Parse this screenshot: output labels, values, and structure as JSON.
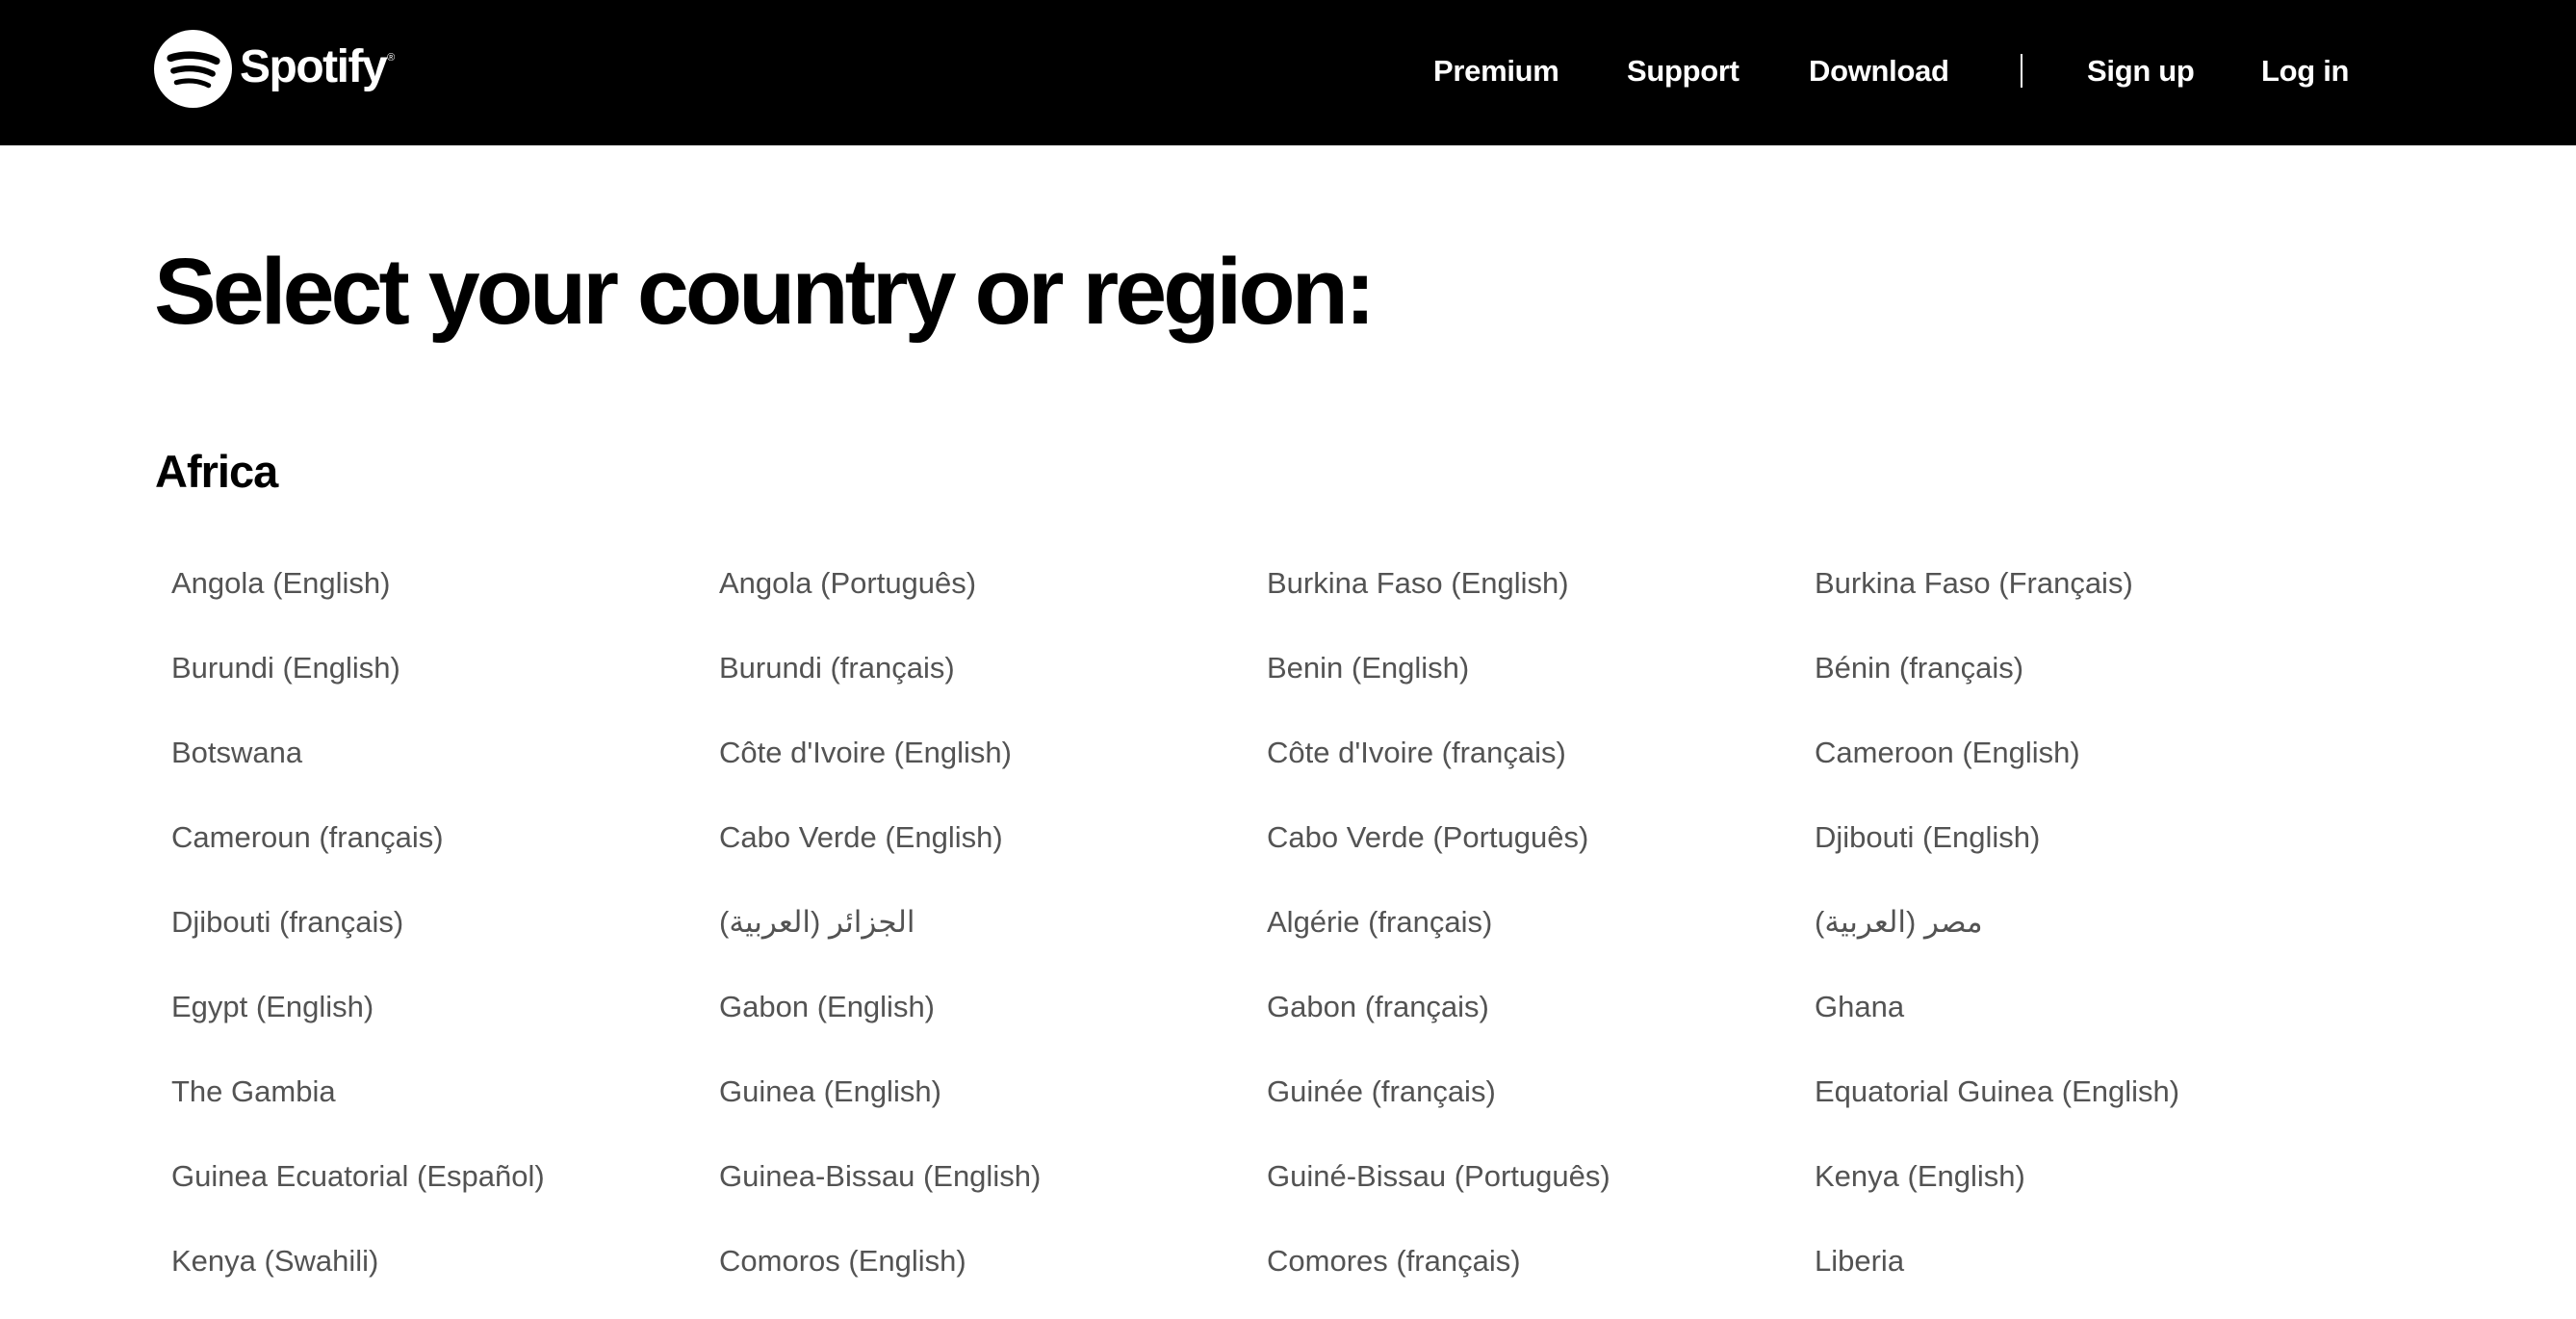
{
  "header": {
    "logo_text": "Spotify",
    "logo_mark": "®",
    "nav": {
      "premium": "Premium",
      "support": "Support",
      "download": "Download",
      "signup": "Sign up",
      "login": "Log in"
    }
  },
  "page": {
    "title": "Select your country or region:"
  },
  "regions": [
    {
      "name": "Africa",
      "countries": [
        "Angola (English)",
        "Angola (Português)",
        "Burkina Faso (English)",
        "Burkina Faso (Français)",
        "Burundi (English)",
        "Burundi (français)",
        "Benin (English)",
        "Bénin (français)",
        "Botswana",
        "Côte d'Ivoire (English)",
        "Côte d'Ivoire (français)",
        "Cameroon (English)",
        "Cameroun (français)",
        "Cabo Verde (English)",
        "Cabo Verde (Português)",
        "Djibouti (English)",
        "Djibouti (français)",
        "الجزائر (العربية)",
        "Algérie (français)",
        "مصر (العربية)",
        "Egypt (English)",
        "Gabon (English)",
        "Gabon (français)",
        "Ghana",
        "The Gambia",
        "Guinea (English)",
        "Guinée (français)",
        "Equatorial Guinea (English)",
        "Guinea Ecuatorial (Español)",
        "Guinea-Bissau (English)",
        "Guiné-Bissau (Português)",
        "Kenya (English)",
        "Kenya (Swahili)",
        "Comoros (English)",
        "Comores (français)",
        "Liberia"
      ]
    }
  ]
}
